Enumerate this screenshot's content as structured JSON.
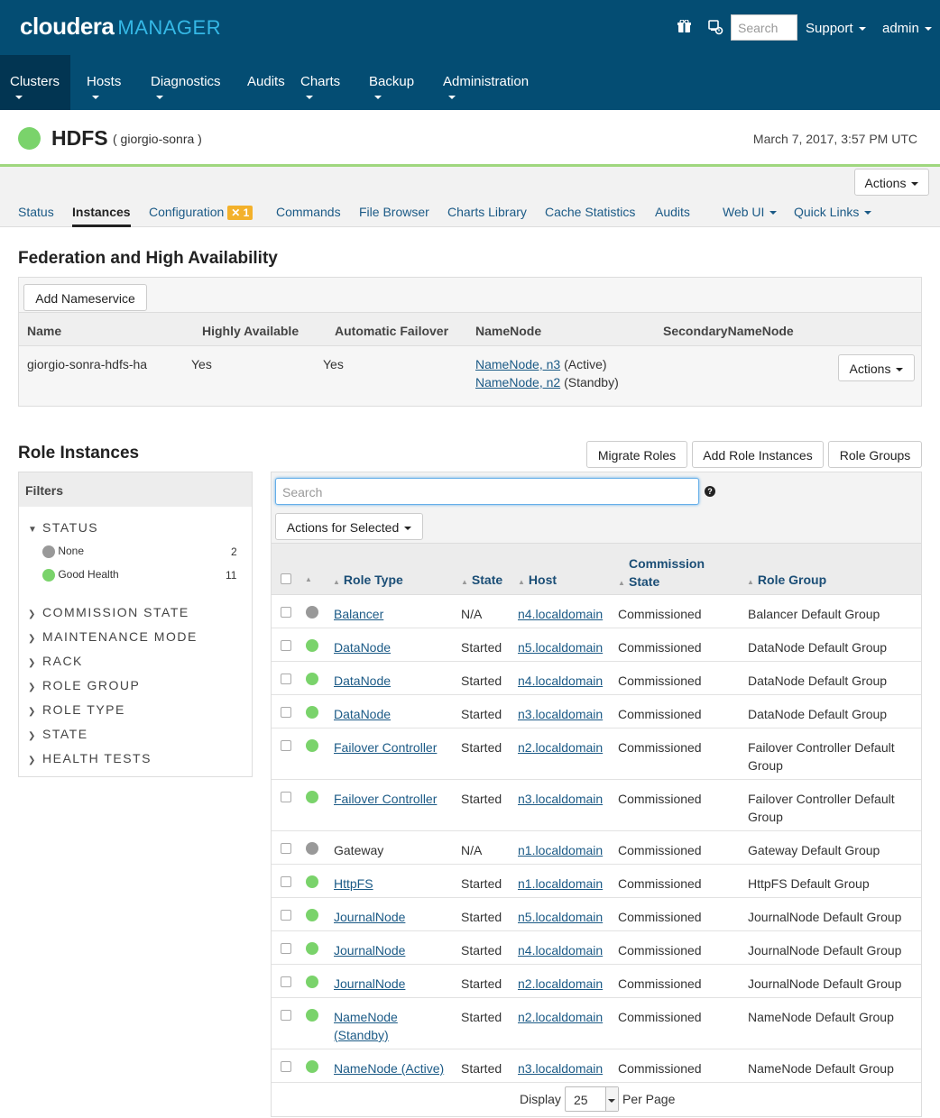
{
  "header": {
    "brand": "cloudera",
    "product": "MANAGER",
    "search_placeholder": "Search",
    "support_label": "Support",
    "user_label": "admin"
  },
  "nav": {
    "items": [
      {
        "label": "Clusters"
      },
      {
        "label": "Hosts"
      },
      {
        "label": "Diagnostics"
      },
      {
        "label": "Audits"
      },
      {
        "label": "Charts"
      },
      {
        "label": "Backup"
      },
      {
        "label": "Administration"
      }
    ]
  },
  "service": {
    "name": "HDFS",
    "cluster": "( giorgio-sonra )",
    "timestamp": "March 7, 2017, 3:57 PM UTC",
    "status_color": "#7ad36b",
    "actions_label": "Actions"
  },
  "tabs": [
    {
      "label": "Status"
    },
    {
      "label": "Instances"
    },
    {
      "label": "Configuration"
    },
    {
      "label": "Commands"
    },
    {
      "label": "File Browser"
    },
    {
      "label": "Charts Library"
    },
    {
      "label": "Cache Statistics"
    },
    {
      "label": "Audits"
    },
    {
      "label": "Web UI"
    },
    {
      "label": "Quick Links"
    }
  ],
  "config_badge": "1",
  "federation": {
    "title": "Federation and High Availability",
    "add_button": "Add Nameservice",
    "columns": [
      "Name",
      "Highly Available",
      "Automatic Failover",
      "NameNode",
      "SecondaryNameNode"
    ],
    "row": {
      "name": "giorgio-sonra-hdfs-ha",
      "highly_available": "Yes",
      "automatic_failover": "Yes",
      "namenode1_link": "NameNode, n3",
      "namenode1_state": "(Active)",
      "namenode2_link": "NameNode, n2",
      "namenode2_state": "(Standby)",
      "actions_label": "Actions"
    }
  },
  "roles": {
    "title": "Role Instances",
    "migrate_button": "Migrate Roles",
    "add_button": "Add Role Instances",
    "groups_button": "Role Groups",
    "search_placeholder": "Search",
    "actions_selected": "Actions for Selected",
    "columns": {
      "role_type": "Role Type",
      "state": "State",
      "host": "Host",
      "commission1": "Commission",
      "commission2": "State",
      "role_group": "Role Group"
    },
    "rows": [
      {
        "status": "grey",
        "role": "Balancer",
        "role_link": true,
        "state": "N/A",
        "host": "n4.localdomain",
        "commission": "Commissioned",
        "group": "Balancer Default Group"
      },
      {
        "status": "green",
        "role": "DataNode",
        "role_link": true,
        "state": "Started",
        "host": "n5.localdomain",
        "commission": "Commissioned",
        "group": "DataNode Default Group"
      },
      {
        "status": "green",
        "role": "DataNode",
        "role_link": true,
        "state": "Started",
        "host": "n4.localdomain",
        "commission": "Commissioned",
        "group": "DataNode Default Group"
      },
      {
        "status": "green",
        "role": "DataNode",
        "role_link": true,
        "state": "Started",
        "host": "n3.localdomain",
        "commission": "Commissioned",
        "group": "DataNode Default Group"
      },
      {
        "status": "green",
        "role": "Failover Controller",
        "role_link": true,
        "state": "Started",
        "host": "n2.localdomain",
        "commission": "Commissioned",
        "group": "Failover Controller Default Group"
      },
      {
        "status": "green",
        "role": "Failover Controller",
        "role_link": true,
        "state": "Started",
        "host": "n3.localdomain",
        "commission": "Commissioned",
        "group": "Failover Controller Default Group"
      },
      {
        "status": "grey",
        "role": "Gateway",
        "role_link": false,
        "state": "N/A",
        "host": "n1.localdomain",
        "commission": "Commissioned",
        "group": "Gateway Default Group"
      },
      {
        "status": "green",
        "role": "HttpFS",
        "role_link": true,
        "state": "Started",
        "host": "n1.localdomain",
        "commission": "Commissioned",
        "group": "HttpFS Default Group"
      },
      {
        "status": "green",
        "role": "JournalNode",
        "role_link": true,
        "state": "Started",
        "host": "n5.localdomain",
        "commission": "Commissioned",
        "group": "JournalNode Default Group"
      },
      {
        "status": "green",
        "role": "JournalNode",
        "role_link": true,
        "state": "Started",
        "host": "n4.localdomain",
        "commission": "Commissioned",
        "group": "JournalNode Default Group"
      },
      {
        "status": "green",
        "role": "JournalNode",
        "role_link": true,
        "state": "Started",
        "host": "n2.localdomain",
        "commission": "Commissioned",
        "group": "JournalNode Default Group"
      },
      {
        "status": "green",
        "role": "NameNode (Standby)",
        "role_link": true,
        "state": "Started",
        "host": "n2.localdomain",
        "commission": "Commissioned",
        "group": "NameNode Default Group"
      },
      {
        "status": "green",
        "role": "NameNode (Active)",
        "role_link": true,
        "state": "Started",
        "host": "n3.localdomain",
        "commission": "Commissioned",
        "group": "NameNode Default Group"
      }
    ],
    "footer": {
      "display_label": "Display",
      "per_page_value": "25",
      "per_page_label": "Per Page"
    }
  },
  "filters": {
    "title": "Filters",
    "status_label": "STATUS",
    "status_items": [
      {
        "label": "None",
        "count": "2",
        "color": "grey"
      },
      {
        "label": "Good Health",
        "count": "11",
        "color": "green"
      }
    ],
    "groups": [
      "COMMISSION STATE",
      "MAINTENANCE MODE",
      "RACK",
      "ROLE GROUP",
      "ROLE TYPE",
      "STATE",
      "HEALTH TESTS"
    ]
  }
}
